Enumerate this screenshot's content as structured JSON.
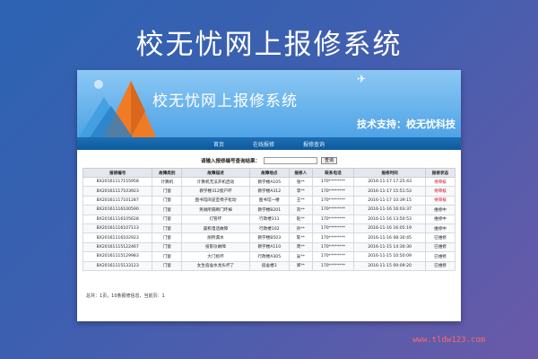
{
  "page_title": "校无忧网上报修系统",
  "banner": {
    "title": "校无忧网上报修系统",
    "support": "技术支持：校无忧科技"
  },
  "nav": {
    "items": [
      {
        "label": "首页"
      },
      {
        "label": "在线报修"
      },
      {
        "label": "报修查询"
      }
    ]
  },
  "query": {
    "label": "请输入报修编号查询结果：",
    "button": "查询",
    "input_value": ""
  },
  "table": {
    "headers": [
      "报修编号",
      "故障类别",
      "故障描述",
      "故障地点",
      "报修人",
      "联系电话",
      "报修时间",
      "报修状态"
    ],
    "rows": [
      [
        "BX20161117155958",
        "计算机",
        "计算机无法开机启动",
        "教学楼A105",
        "张**",
        "170********",
        "2016-11-17 17:25:43",
        "待审核"
      ],
      [
        "BX20161117103923",
        "门窗",
        "教学楼312窗户坏",
        "教学楼A312",
        "李**",
        "170********",
        "2016-11-17 15:51:53",
        "待审核"
      ],
      [
        "BX20161117101287",
        "门窗",
        "图书馆阅览室椅子松动",
        "图书馆一楼",
        "王**",
        "170********",
        "2016-11-17 10:39:15",
        "待审核"
      ],
      [
        "BX20161116100590",
        "门窗",
        "男厕所隔断门坏掉",
        "教学楼B201",
        "刘**",
        "170********",
        "2016-11-16 16:03:37",
        "维修中"
      ],
      [
        "BX20161116105628",
        "门窗",
        "灯管坏",
        "行政楼311",
        "赵**",
        "170********",
        "2016-11-16 13:50:53",
        "维修中"
      ],
      [
        "BX20161116107113",
        "门窗",
        "座机电话故障",
        "行政楼102",
        "孙**",
        "170********",
        "2016-11-16 16:05:19",
        "维修中"
      ],
      [
        "BX20161116102923",
        "门窗",
        "厕所漏水",
        "教学楼B503",
        "陈**",
        "170********",
        "2016-11-16 08:30:45",
        "已维修"
      ],
      [
        "BX20161115122467",
        "门窗",
        "投影仪故障",
        "教学楼A110",
        "周**",
        "170********",
        "2016-11-15 14:30:30",
        "已维修"
      ],
      [
        "BX20161115129983",
        "门窗",
        "大门损坏",
        "行政楼A305",
        "吴**",
        "170********",
        "2016-11-15 10:50:09",
        "已维修"
      ],
      [
        "BX20161115133123",
        "门窗",
        "女生宿舍水龙头坏了",
        "宿舍楼3",
        "郑**",
        "170********",
        "2016-11-15 09:09:20",
        "已维修"
      ]
    ]
  },
  "footer": "总共：1页，10条报修信息，当前页：1",
  "watermark": "www.tldw123.com",
  "colors": {
    "background": "#3d5fb0",
    "nav": "#0d5a9c",
    "status_pending": "#d0021b"
  }
}
